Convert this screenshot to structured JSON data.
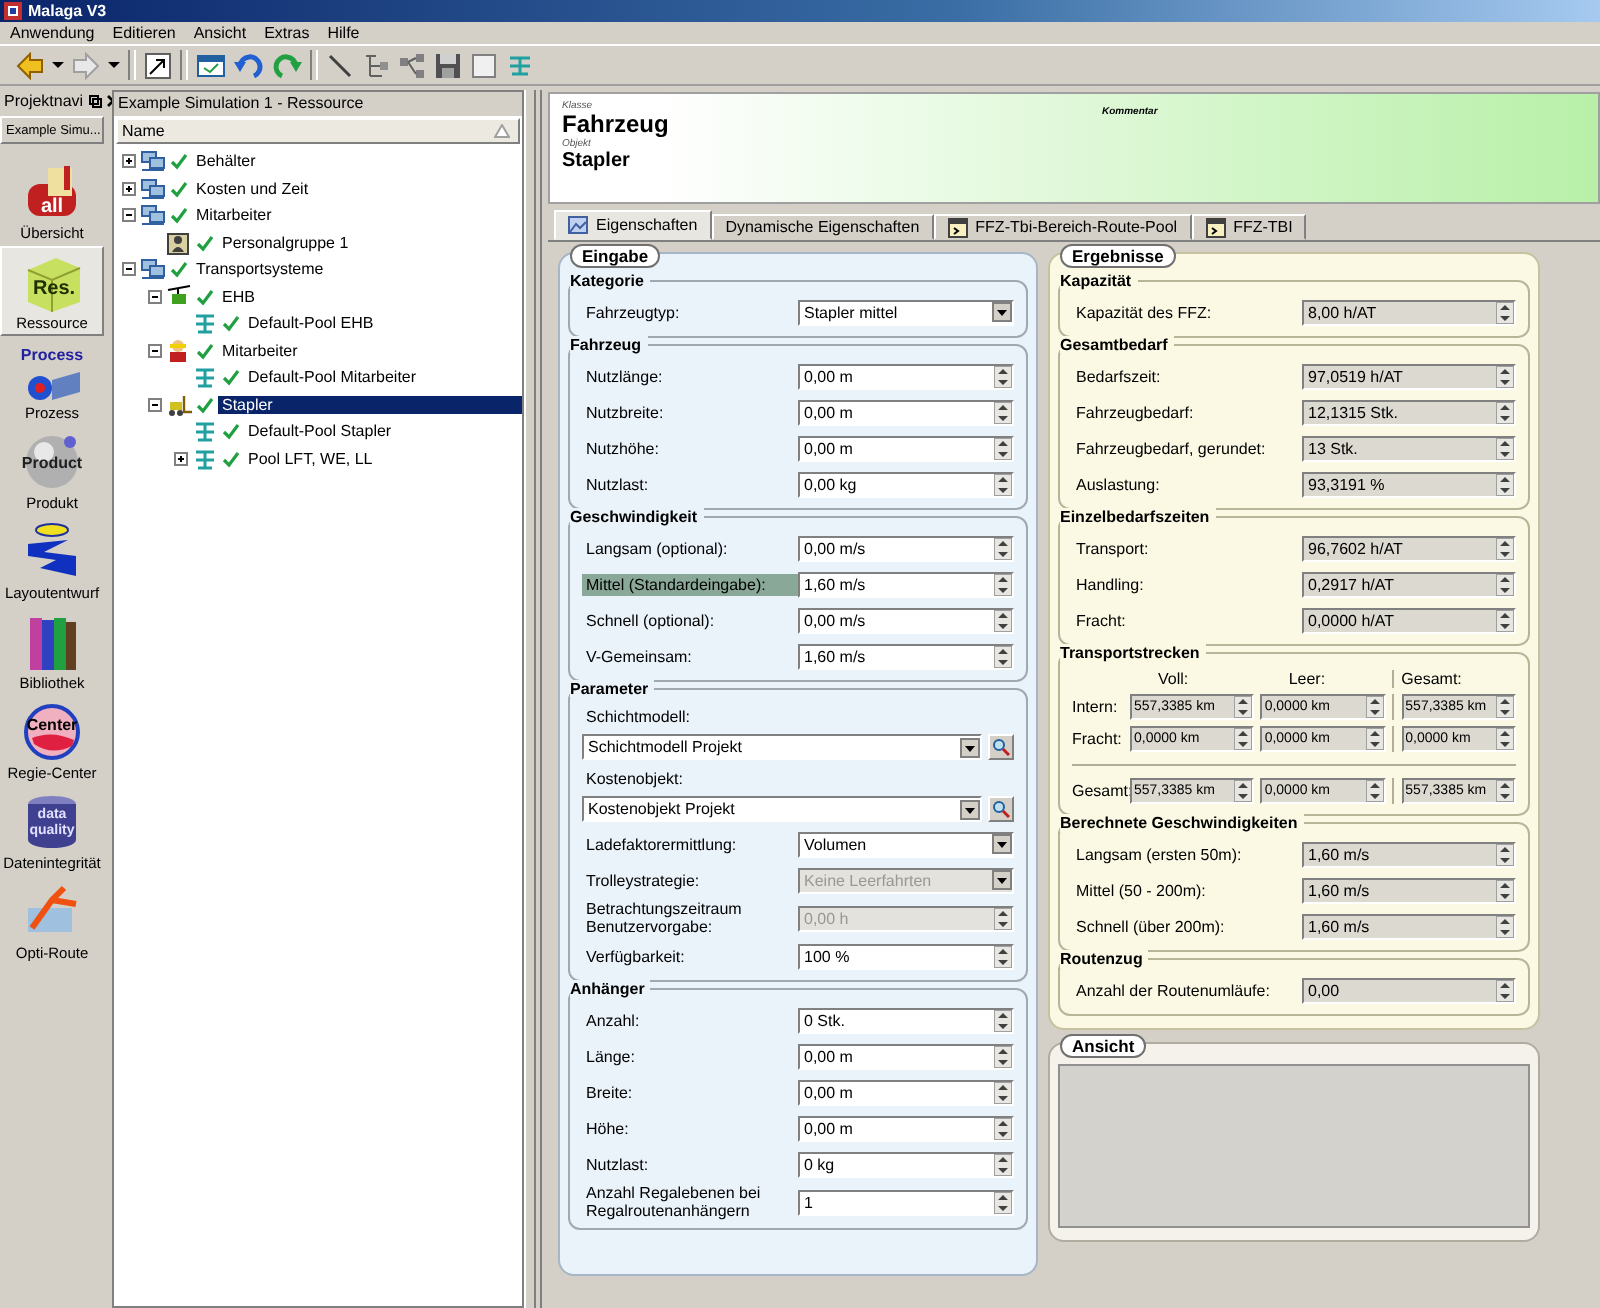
{
  "window": {
    "title": "Malaga V3"
  },
  "menu": [
    {
      "label": "Anwendung"
    },
    {
      "label": "Editieren"
    },
    {
      "label": "Ansicht"
    },
    {
      "label": "Extras"
    },
    {
      "label": "Hilfe"
    }
  ],
  "toolbar": [
    {
      "kind": "back"
    },
    {
      "kind": "caret"
    },
    {
      "kind": "forward"
    },
    {
      "kind": "caret"
    },
    {
      "kind": "sep"
    },
    {
      "kind": "resize"
    },
    {
      "kind": "sep"
    },
    {
      "kind": "form"
    },
    {
      "kind": "undo"
    },
    {
      "kind": "redo"
    },
    {
      "kind": "sep"
    },
    {
      "kind": "line"
    },
    {
      "kind": "tree"
    },
    {
      "kind": "nodes"
    },
    {
      "kind": "save"
    },
    {
      "kind": "square"
    },
    {
      "kind": "pool"
    }
  ],
  "navigator": {
    "title": "Projektnavi",
    "project": "Example Simu...",
    "items": [
      {
        "label": "Übersicht",
        "kind": "mailbox",
        "icon_text": "all",
        "selected": false
      },
      {
        "label": "Ressource",
        "kind": "cube",
        "icon_text": "Res.",
        "selected": true
      },
      {
        "label": "Prozess",
        "kind": "process",
        "icon_text": "Process",
        "selected": false
      },
      {
        "label": "Produkt",
        "kind": "sphere",
        "icon_text": "Product",
        "selected": false
      },
      {
        "label": "Layoutentwurf",
        "kind": "layout",
        "selected": false
      },
      {
        "label": "Bibliothek",
        "kind": "books",
        "selected": false
      },
      {
        "label": "Regie-Center",
        "kind": "globe",
        "icon_text": "Center",
        "selected": false
      },
      {
        "label": "Datenintegrität",
        "kind": "cylinder",
        "icon_text": "data quality",
        "selected": false
      },
      {
        "label": "Opti-Route",
        "kind": "route",
        "selected": false
      }
    ]
  },
  "tree": {
    "title": "Example Simulation 1 - Ressource",
    "column": "Name",
    "items": [
      {
        "label": "Behälter",
        "kind": "group",
        "expanded": false,
        "selected": false
      },
      {
        "label": "Kosten und Zeit",
        "kind": "group",
        "expanded": false,
        "selected": false
      },
      {
        "label": "Mitarbeiter",
        "kind": "group",
        "expanded": true,
        "selected": false,
        "children": [
          {
            "label": "Personalgruppe 1",
            "kind": "person",
            "selected": false
          }
        ]
      },
      {
        "label": "Transportsysteme",
        "kind": "group",
        "expanded": true,
        "selected": false,
        "children": [
          {
            "label": "EHB",
            "kind": "ehb",
            "expanded": true,
            "selected": false,
            "children": [
              {
                "label": "Default-Pool EHB",
                "kind": "pool",
                "selected": false
              }
            ]
          },
          {
            "label": "Mitarbeiter",
            "kind": "worker",
            "expanded": true,
            "selected": false,
            "children": [
              {
                "label": "Default-Pool Mitarbeiter",
                "kind": "pool",
                "selected": false
              }
            ]
          },
          {
            "label": "Stapler",
            "kind": "forklift",
            "expanded": true,
            "selected": true,
            "children": [
              {
                "label": "Default-Pool Stapler",
                "kind": "pool",
                "selected": false
              },
              {
                "label": "Pool LFT, WE, LL",
                "kind": "pool",
                "expanded": false,
                "selected": false
              }
            ]
          }
        ]
      }
    ]
  },
  "header": {
    "class_label": "Klasse",
    "class_value": "Fahrzeug",
    "object_label": "Objekt",
    "object_value": "Stapler",
    "comment_label": "Kommentar"
  },
  "tabs": [
    {
      "label": "Eigenschaften",
      "kind": "properties",
      "selected": true
    },
    {
      "label": "Dynamische Eigenschaften",
      "kind": "plain",
      "selected": false
    },
    {
      "label": "FFZ-Tbi-Bereich-Route-Pool",
      "kind": "window",
      "selected": false
    },
    {
      "label": "FFZ-TBI",
      "kind": "window",
      "selected": false
    }
  ],
  "input_panel": {
    "title": "Eingabe",
    "groups": [
      {
        "title": "Kategorie",
        "rows": [
          {
            "kind": "select",
            "label": "Fahrzeugtyp:",
            "value": "Stapler mittel",
            "disabled": false
          }
        ]
      },
      {
        "title": "Fahrzeug",
        "rows": [
          {
            "kind": "spin",
            "label": "Nutzlänge:",
            "value": "0,00 m",
            "disabled": false
          },
          {
            "kind": "spin",
            "label": "Nutzbreite:",
            "value": "0,00 m",
            "disabled": false
          },
          {
            "kind": "spin",
            "label": "Nutzhöhe:",
            "value": "0,00 m",
            "disabled": false
          },
          {
            "kind": "spin",
            "label": "Nutzlast:",
            "value": "0,00 kg",
            "disabled": false
          }
        ]
      },
      {
        "title": "Geschwindigkeit",
        "rows": [
          {
            "kind": "spin",
            "label": "Langsam (optional):",
            "value": "0,00 m/s",
            "disabled": false
          },
          {
            "kind": "spin",
            "label": "Mittel (Standardeingabe):",
            "value": "1,60 m/s",
            "disabled": false,
            "highlighted": true
          },
          {
            "kind": "spin",
            "label": "Schnell (optional):",
            "value": "0,00 m/s",
            "disabled": false
          },
          {
            "kind": "spin",
            "label": "V-Gemeinsam:",
            "value": "1,60 m/s",
            "disabled": false
          }
        ]
      },
      {
        "title": "Parameter",
        "rows": [
          {
            "kind": "lookup",
            "label": "Schichtmodell:",
            "value": "Schichtmodell Projekt",
            "disabled": false
          },
          {
            "kind": "lookup",
            "label": "Kostenobjekt:",
            "value": "Kostenobjekt Projekt",
            "disabled": false
          },
          {
            "kind": "select",
            "label": "Ladefaktorermittlung:",
            "value": "Volumen",
            "disabled": false
          },
          {
            "kind": "select",
            "label": "Trolleystrategie:",
            "value": "Keine Leerfahrten",
            "disabled": true
          },
          {
            "kind": "spin",
            "label": "Betrachtungszeitraum Benutzervorgabe:",
            "value": "0,00 h",
            "disabled": true
          },
          {
            "kind": "spin",
            "label": "Verfügbarkeit:",
            "value": "100 %",
            "disabled": false
          }
        ]
      },
      {
        "title": "Anhänger",
        "rows": [
          {
            "kind": "spin",
            "label": "Anzahl:",
            "value": "0 Stk.",
            "disabled": false
          },
          {
            "kind": "spin",
            "label": "Länge:",
            "value": "0,00 m",
            "disabled": false
          },
          {
            "kind": "spin",
            "label": "Breite:",
            "value": "0,00 m",
            "disabled": false
          },
          {
            "kind": "spin",
            "label": "Höhe:",
            "value": "0,00 m",
            "disabled": false
          },
          {
            "kind": "spin",
            "label": "Nutzlast:",
            "value": "0 kg",
            "disabled": false
          },
          {
            "kind": "spin",
            "label": "Anzahl Regalebenen bei Regalroutenanhängern",
            "value": "1",
            "disabled": false
          }
        ]
      }
    ]
  },
  "results_panel": {
    "title": "Ergebnisse",
    "groups": [
      {
        "kind": "fields",
        "title": "Kapazität",
        "rows": [
          {
            "label": "Kapazität des FFZ:",
            "value": "8,00 h/AT"
          }
        ]
      },
      {
        "kind": "fields",
        "title": "Gesamtbedarf",
        "rows": [
          {
            "label": "Bedarfszeit:",
            "value": "97,0519 h/AT"
          },
          {
            "label": "Fahrzeugbedarf:",
            "value": "12,1315 Stk."
          },
          {
            "label": "Fahrzeugbedarf, gerundet:",
            "value": "13 Stk."
          },
          {
            "label": "Auslastung:",
            "value": "93,3191 %"
          }
        ]
      },
      {
        "kind": "fields",
        "title": "Einzelbedarfszeiten",
        "rows": [
          {
            "label": "Transport:",
            "value": "96,7602 h/AT"
          },
          {
            "label": "Handling:",
            "value": "0,2917 h/AT"
          },
          {
            "label": "Fracht:",
            "value": "0,0000 h/AT"
          }
        ]
      },
      {
        "kind": "matrix",
        "title": "Transportstrecken",
        "columns": [
          "Voll:",
          "Leer:",
          "Gesamt:"
        ],
        "rows": [
          {
            "kind": "detail",
            "label": "Intern:",
            "values": [
              "557,3385 km",
              "0,0000 km",
              "557,3385 km"
            ]
          },
          {
            "kind": "detail",
            "label": "Fracht:",
            "values": [
              "0,0000 km",
              "0,0000 km",
              "0,0000 km"
            ]
          },
          {
            "kind": "total",
            "label": "Gesamt:",
            "values": [
              "557,3385 km",
              "0,0000 km",
              "557,3385 km"
            ]
          }
        ]
      },
      {
        "kind": "fields",
        "title": "Berechnete Geschwindigkeiten",
        "rows": [
          {
            "label": "Langsam (ersten 50m):",
            "value": "1,60 m/s"
          },
          {
            "label": "Mittel (50 - 200m):",
            "value": "1,60 m/s"
          },
          {
            "label": "Schnell (über 200m):",
            "value": "1,60 m/s"
          }
        ]
      },
      {
        "kind": "fields",
        "title": "Routenzug",
        "rows": [
          {
            "label": "Anzahl der Routenumläufe:",
            "value": "0,00"
          }
        ]
      }
    ]
  },
  "view_panel": {
    "title": "Ansicht"
  }
}
